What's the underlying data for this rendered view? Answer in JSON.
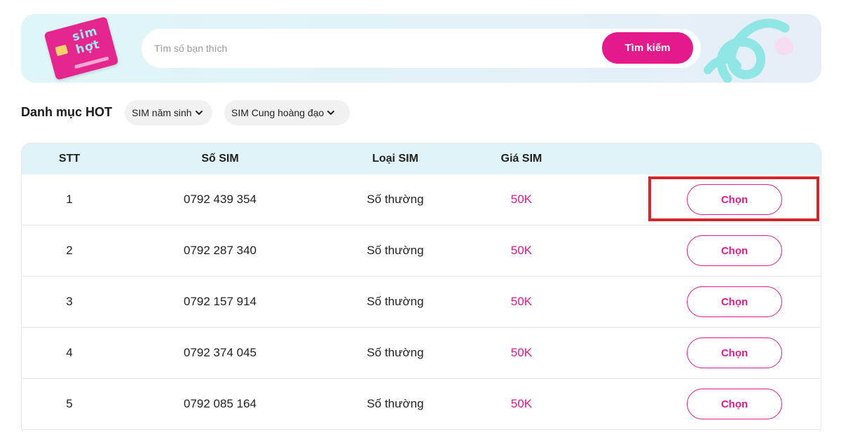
{
  "search": {
    "placeholder": "Tìm số bạn thích",
    "button_label": "Tìm kiếm",
    "sim_card_art": "sim\nhợt"
  },
  "categories": {
    "title": "Danh mục HOT",
    "chips": [
      {
        "label": "SIM năm sinh",
        "icon": "chevron-down-icon"
      },
      {
        "label": "SIM Cung hoàng đạo",
        "icon": "chevron-down-icon"
      }
    ]
  },
  "table": {
    "headers": [
      "STT",
      "Số SIM",
      "Loại SIM",
      "Giá SIM"
    ],
    "rows": [
      {
        "stt": "1",
        "number": "0792 439 354",
        "type": "Số thường",
        "price": "50K",
        "action": "Chọn"
      },
      {
        "stt": "2",
        "number": "0792 287 340",
        "type": "Số thường",
        "price": "50K",
        "action": "Chọn"
      },
      {
        "stt": "3",
        "number": "0792 157 914",
        "type": "Số thường",
        "price": "50K",
        "action": "Chọn"
      },
      {
        "stt": "4",
        "number": "0792 374 045",
        "type": "Số thường",
        "price": "50K",
        "action": "Chọn"
      },
      {
        "stt": "5",
        "number": "0792 085 164",
        "type": "Số thường",
        "price": "50K",
        "action": "Chọn"
      }
    ]
  },
  "colors": {
    "accent": "#e4198b",
    "header_bg": "#dff3f8",
    "highlight": "#d3272e"
  }
}
